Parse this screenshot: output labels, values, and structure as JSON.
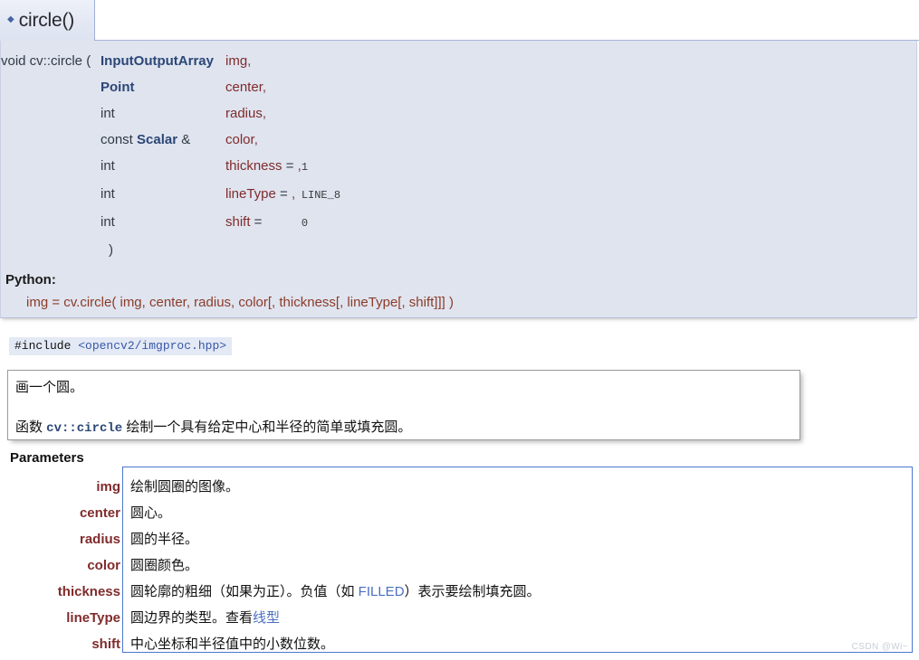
{
  "header": {
    "bullet_icon": "diamond-bullet-icon",
    "tab_title": "circle()"
  },
  "signature": {
    "return_type": "void cv::circle (",
    "close_paren": ")",
    "rows": [
      {
        "type": "InputOutputArray",
        "type_bold": true,
        "const_prefix": "",
        "amp": "",
        "name": "img",
        "comma": ",",
        "eq": "",
        "default": ""
      },
      {
        "type": "Point",
        "type_bold": true,
        "const_prefix": "",
        "amp": "",
        "name": "center",
        "comma": ",",
        "eq": "",
        "default": ""
      },
      {
        "type": "int",
        "type_bold": false,
        "const_prefix": "",
        "amp": "",
        "name": "radius",
        "comma": ",",
        "eq": "",
        "default": ""
      },
      {
        "type": "Scalar",
        "type_bold": true,
        "const_prefix": "const ",
        "amp": " &",
        "name": "color",
        "comma": ",",
        "eq": "",
        "default": ""
      },
      {
        "type": "int",
        "type_bold": false,
        "const_prefix": "",
        "amp": "",
        "name": "thickness",
        "comma": ",",
        "eq": " = ",
        "default": "1"
      },
      {
        "type": "int",
        "type_bold": false,
        "const_prefix": "",
        "amp": "",
        "name": "lineType",
        "comma": ",",
        "eq": " = ",
        "default": "LINE_8"
      },
      {
        "type": "int",
        "type_bold": false,
        "const_prefix": "",
        "amp": "",
        "name": "shift",
        "comma": "",
        "eq": " = ",
        "default": "0"
      }
    ]
  },
  "python": {
    "label": "Python:",
    "signature": "img = cv.circle( img, center, radius, color[, thickness[, lineType[, shift]]] )"
  },
  "include": {
    "directive": "#include ",
    "path": "<opencv2/imgproc.hpp>"
  },
  "description": {
    "line1": "画一个圆。",
    "line2_prefix": "函数 ",
    "line2_code": "cv::circle",
    "line2_suffix": " 绘制一个具有给定中心和半径的简单或填充圆。"
  },
  "parameters": {
    "heading": "Parameters",
    "rows": [
      {
        "name": "img",
        "desc": "绘制圆圈的图像。"
      },
      {
        "name": "center",
        "desc": "圆心。"
      },
      {
        "name": "radius",
        "desc": "圆的半径。"
      },
      {
        "name": "color",
        "desc": "圆圈颜色。"
      },
      {
        "name": "thickness",
        "desc_pre": "圆轮廓的粗细（如果为正）。负值（如 ",
        "desc_link": "FILLED",
        "desc_post": "）表示要绘制填充圆。"
      },
      {
        "name": "lineType",
        "desc_pre": "圆边界的类型。查看",
        "desc_link": "线型",
        "desc_post": ""
      },
      {
        "name": "shift",
        "desc": "中心坐标和半径值中的小数位数。"
      }
    ]
  },
  "watermark": {
    "text": "CSDN @Wi~"
  },
  "colors": {
    "signature_bg": "#dfe4ef",
    "type_blue": "#2b4776",
    "param_maroon": "#802b2b",
    "link_blue": "#4a6fc0",
    "panel_border": "#4a78d0",
    "python_orange": "#8c3b28"
  }
}
